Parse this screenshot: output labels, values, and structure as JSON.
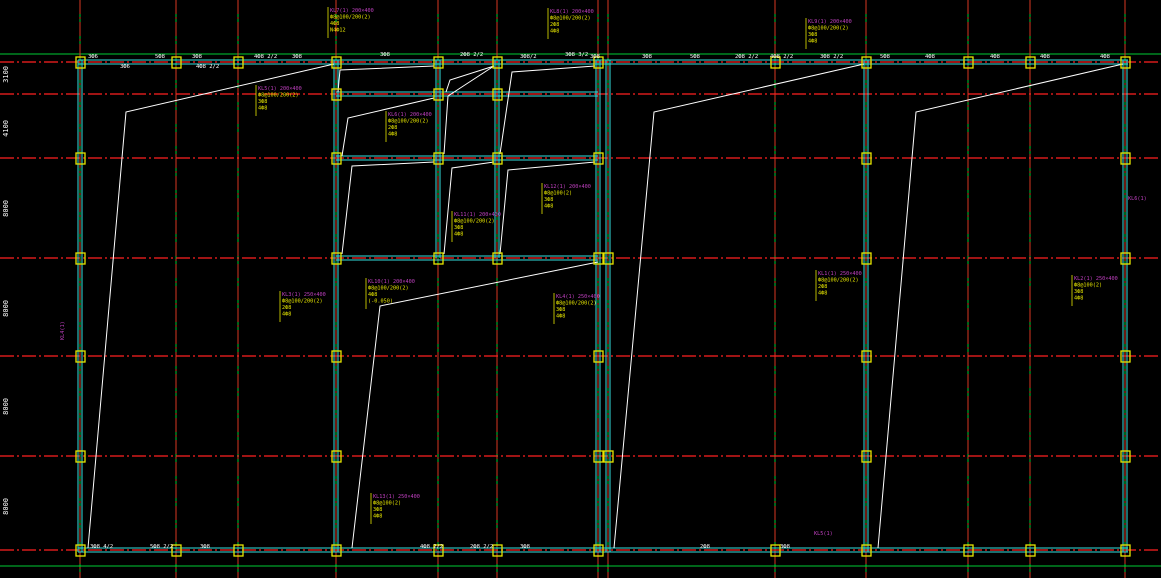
{
  "drawing": {
    "colors": {
      "background": "#000000",
      "grid_vertical": "#00cc33",
      "grid_horizontal": "#ff2020",
      "beam": "#33e0e0",
      "column": "#e6e600",
      "slab_break_line": "#ffffff",
      "annotation_magenta": "#c040c0",
      "annotation_yellow": "#e6e600",
      "annotation_white": "#ffffff"
    },
    "left_dimensions": [
      "3100",
      "4100",
      "8000",
      "8000",
      "8000",
      "8000"
    ],
    "beam_labels": [
      "3Ф6",
      "3Ф6",
      "5Ф8",
      "3Ф8",
      "4Ф8 2/2",
      "4Ф8 2/2",
      "3Ф8",
      "3Ф8",
      "2Ф8 2/2",
      "3Ф8/2",
      "3Ф8 3/2",
      "3Ф8",
      "3Ф8",
      "5Ф8",
      "2Ф8 2/2",
      "4Ф8 2/2",
      "3Ф8 2/2",
      "5Ф8",
      "4Ф8",
      "4Ф8",
      "4Ф8",
      "4Ф8",
      "3Ф8",
      "3Ф8 4/2",
      "5Ф8 2/2",
      "4Ф8 2/2",
      "2Ф8 2/2",
      "3Ф8",
      "2Ф8",
      "3Ф8"
    ],
    "annotations": [
      {
        "lines": [
          "KL7(1) 200×400",
          "Ф8@100/200(2)",
          "4Ф8",
          "N4Ф12"
        ]
      },
      {
        "lines": [
          "KL8(1) 200×400",
          "Ф8@100/200(2)",
          "2Ф8",
          "4Ф8"
        ]
      },
      {
        "lines": [
          "KL9(1) 200×400",
          "Ф8@100/200(2)",
          "3Ф8",
          "4Ф8"
        ]
      },
      {
        "lines": [
          "KL5(1) 200×400",
          "Ф8@100/200(2)",
          "3Ф8",
          "4Ф8"
        ]
      },
      {
        "lines": [
          "KL6(1) 200×400",
          "Ф8@100/200(2)",
          "2Ф8",
          "4Ф8"
        ]
      },
      {
        "lines": [
          "KL10(1) 200×400",
          "Ф8@100/200(2)",
          "4Ф8",
          "(-0.050)"
        ]
      },
      {
        "lines": [
          "KL11(1) 200×400",
          "Ф8@100/200(2)",
          "3Ф8",
          "4Ф8"
        ]
      },
      {
        "lines": [
          "KL12(1) 200×400",
          "Ф8@100(2)",
          "3Ф8",
          "4Ф8"
        ]
      },
      {
        "lines": [
          "KL3(1) 250×400",
          "Ф8@100/200(2)",
          "2Ф8",
          "4Ф8"
        ]
      },
      {
        "lines": [
          "KL4(1) 250×400",
          "Ф8@100/200(2)",
          "3Ф8",
          "4Ф8"
        ]
      },
      {
        "lines": [
          "KL1(1) 250×400",
          "Ф8@100/200(2)",
          "2Ф8",
          "4Ф8"
        ]
      },
      {
        "lines": [
          "KL2(1) 250×400",
          "Ф8@100(2)",
          "3Ф8",
          "4Ф8"
        ]
      },
      {
        "lines": [
          "KL13(1) 250×400",
          "Ф8@100(2)",
          "3Ф8",
          "4Ф8"
        ]
      }
    ],
    "side_tags": [
      "KL4(1)",
      "KL5(1)",
      "KL6(1)"
    ]
  }
}
